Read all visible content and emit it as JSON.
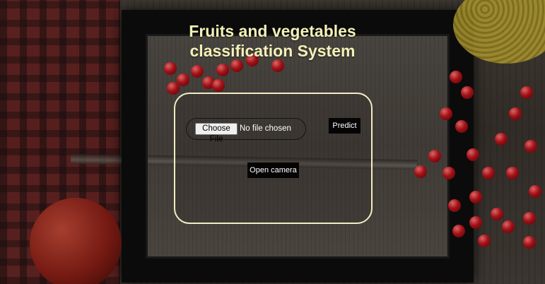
{
  "page": {
    "title_line1": "Fruits and vegetables",
    "title_line2": "classification System"
  },
  "upload": {
    "choose_file_label": "Choose File",
    "file_status": "No file chosen"
  },
  "actions": {
    "predict_label": "Predict",
    "open_camera_label": "Open camera"
  },
  "colors": {
    "title": "#f4f0b8",
    "panel_border": "#f1ecc2",
    "button_bg": "#050505",
    "button_text": "#ffffff"
  }
}
